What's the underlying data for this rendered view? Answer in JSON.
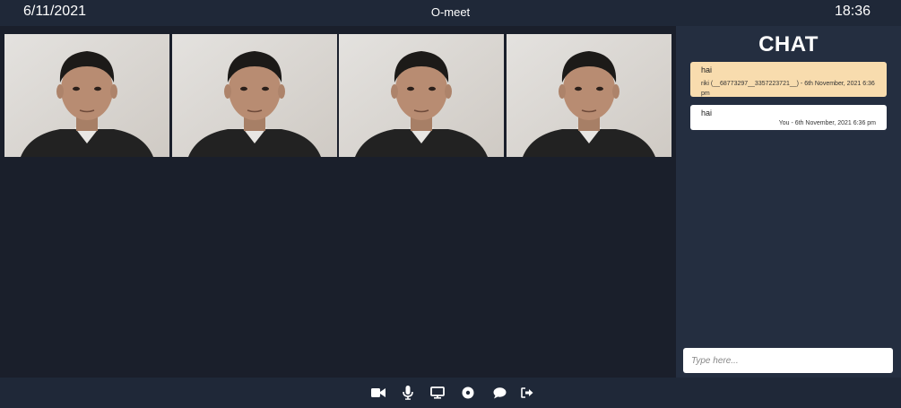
{
  "header": {
    "date": "6/11/2021",
    "title": "O-meet",
    "time": "18:36"
  },
  "videos": [
    {
      "name": "participant-video-1"
    },
    {
      "name": "participant-video-2"
    },
    {
      "name": "participant-video-3"
    },
    {
      "name": "participant-video-4"
    }
  ],
  "chat": {
    "title": "CHAT",
    "messages": [
      {
        "text": "hai",
        "meta": "riki (__68773297__3357223721__) - 6th November, 2021 6:36 pm",
        "from": "other"
      },
      {
        "text": "hai",
        "meta": "You - 6th November, 2021 6:36 pm",
        "from": "me"
      }
    ],
    "input_placeholder": "Type here..."
  },
  "controls": [
    {
      "icon": "video-camera-icon"
    },
    {
      "icon": "microphone-icon"
    },
    {
      "icon": "screen-share-icon"
    },
    {
      "icon": "record-icon"
    },
    {
      "icon": "chat-bubble-icon"
    },
    {
      "icon": "leave-icon"
    }
  ],
  "colors": {
    "background": "#1a202c",
    "panel": "#242e40",
    "bar": "#1f2838",
    "message_other": "#f8dcae",
    "message_me": "#ffffff"
  }
}
